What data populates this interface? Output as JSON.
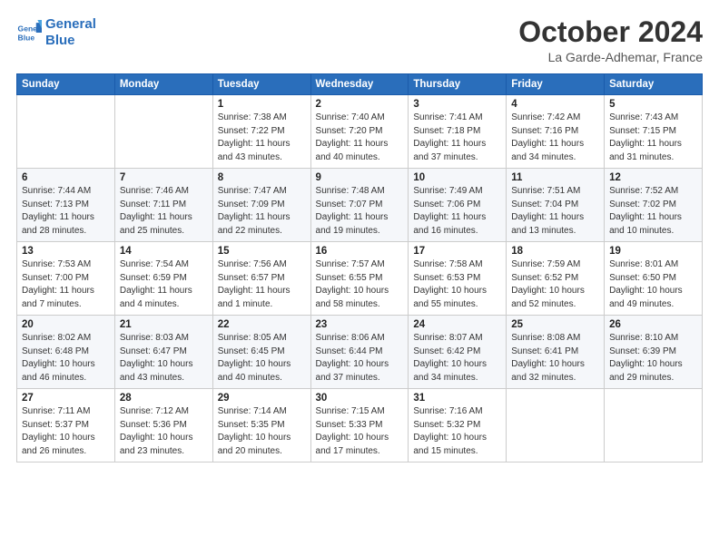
{
  "header": {
    "logo_line1": "General",
    "logo_line2": "Blue",
    "month": "October 2024",
    "location": "La Garde-Adhemar, France"
  },
  "days_of_week": [
    "Sunday",
    "Monday",
    "Tuesday",
    "Wednesday",
    "Thursday",
    "Friday",
    "Saturday"
  ],
  "weeks": [
    [
      {
        "day": "",
        "info": ""
      },
      {
        "day": "",
        "info": ""
      },
      {
        "day": "1",
        "info": "Sunrise: 7:38 AM\nSunset: 7:22 PM\nDaylight: 11 hours and 43 minutes."
      },
      {
        "day": "2",
        "info": "Sunrise: 7:40 AM\nSunset: 7:20 PM\nDaylight: 11 hours and 40 minutes."
      },
      {
        "day": "3",
        "info": "Sunrise: 7:41 AM\nSunset: 7:18 PM\nDaylight: 11 hours and 37 minutes."
      },
      {
        "day": "4",
        "info": "Sunrise: 7:42 AM\nSunset: 7:16 PM\nDaylight: 11 hours and 34 minutes."
      },
      {
        "day": "5",
        "info": "Sunrise: 7:43 AM\nSunset: 7:15 PM\nDaylight: 11 hours and 31 minutes."
      }
    ],
    [
      {
        "day": "6",
        "info": "Sunrise: 7:44 AM\nSunset: 7:13 PM\nDaylight: 11 hours and 28 minutes."
      },
      {
        "day": "7",
        "info": "Sunrise: 7:46 AM\nSunset: 7:11 PM\nDaylight: 11 hours and 25 minutes."
      },
      {
        "day": "8",
        "info": "Sunrise: 7:47 AM\nSunset: 7:09 PM\nDaylight: 11 hours and 22 minutes."
      },
      {
        "day": "9",
        "info": "Sunrise: 7:48 AM\nSunset: 7:07 PM\nDaylight: 11 hours and 19 minutes."
      },
      {
        "day": "10",
        "info": "Sunrise: 7:49 AM\nSunset: 7:06 PM\nDaylight: 11 hours and 16 minutes."
      },
      {
        "day": "11",
        "info": "Sunrise: 7:51 AM\nSunset: 7:04 PM\nDaylight: 11 hours and 13 minutes."
      },
      {
        "day": "12",
        "info": "Sunrise: 7:52 AM\nSunset: 7:02 PM\nDaylight: 11 hours and 10 minutes."
      }
    ],
    [
      {
        "day": "13",
        "info": "Sunrise: 7:53 AM\nSunset: 7:00 PM\nDaylight: 11 hours and 7 minutes."
      },
      {
        "day": "14",
        "info": "Sunrise: 7:54 AM\nSunset: 6:59 PM\nDaylight: 11 hours and 4 minutes."
      },
      {
        "day": "15",
        "info": "Sunrise: 7:56 AM\nSunset: 6:57 PM\nDaylight: 11 hours and 1 minute."
      },
      {
        "day": "16",
        "info": "Sunrise: 7:57 AM\nSunset: 6:55 PM\nDaylight: 10 hours and 58 minutes."
      },
      {
        "day": "17",
        "info": "Sunrise: 7:58 AM\nSunset: 6:53 PM\nDaylight: 10 hours and 55 minutes."
      },
      {
        "day": "18",
        "info": "Sunrise: 7:59 AM\nSunset: 6:52 PM\nDaylight: 10 hours and 52 minutes."
      },
      {
        "day": "19",
        "info": "Sunrise: 8:01 AM\nSunset: 6:50 PM\nDaylight: 10 hours and 49 minutes."
      }
    ],
    [
      {
        "day": "20",
        "info": "Sunrise: 8:02 AM\nSunset: 6:48 PM\nDaylight: 10 hours and 46 minutes."
      },
      {
        "day": "21",
        "info": "Sunrise: 8:03 AM\nSunset: 6:47 PM\nDaylight: 10 hours and 43 minutes."
      },
      {
        "day": "22",
        "info": "Sunrise: 8:05 AM\nSunset: 6:45 PM\nDaylight: 10 hours and 40 minutes."
      },
      {
        "day": "23",
        "info": "Sunrise: 8:06 AM\nSunset: 6:44 PM\nDaylight: 10 hours and 37 minutes."
      },
      {
        "day": "24",
        "info": "Sunrise: 8:07 AM\nSunset: 6:42 PM\nDaylight: 10 hours and 34 minutes."
      },
      {
        "day": "25",
        "info": "Sunrise: 8:08 AM\nSunset: 6:41 PM\nDaylight: 10 hours and 32 minutes."
      },
      {
        "day": "26",
        "info": "Sunrise: 8:10 AM\nSunset: 6:39 PM\nDaylight: 10 hours and 29 minutes."
      }
    ],
    [
      {
        "day": "27",
        "info": "Sunrise: 7:11 AM\nSunset: 5:37 PM\nDaylight: 10 hours and 26 minutes."
      },
      {
        "day": "28",
        "info": "Sunrise: 7:12 AM\nSunset: 5:36 PM\nDaylight: 10 hours and 23 minutes."
      },
      {
        "day": "29",
        "info": "Sunrise: 7:14 AM\nSunset: 5:35 PM\nDaylight: 10 hours and 20 minutes."
      },
      {
        "day": "30",
        "info": "Sunrise: 7:15 AM\nSunset: 5:33 PM\nDaylight: 10 hours and 17 minutes."
      },
      {
        "day": "31",
        "info": "Sunrise: 7:16 AM\nSunset: 5:32 PM\nDaylight: 10 hours and 15 minutes."
      },
      {
        "day": "",
        "info": ""
      },
      {
        "day": "",
        "info": ""
      }
    ]
  ]
}
